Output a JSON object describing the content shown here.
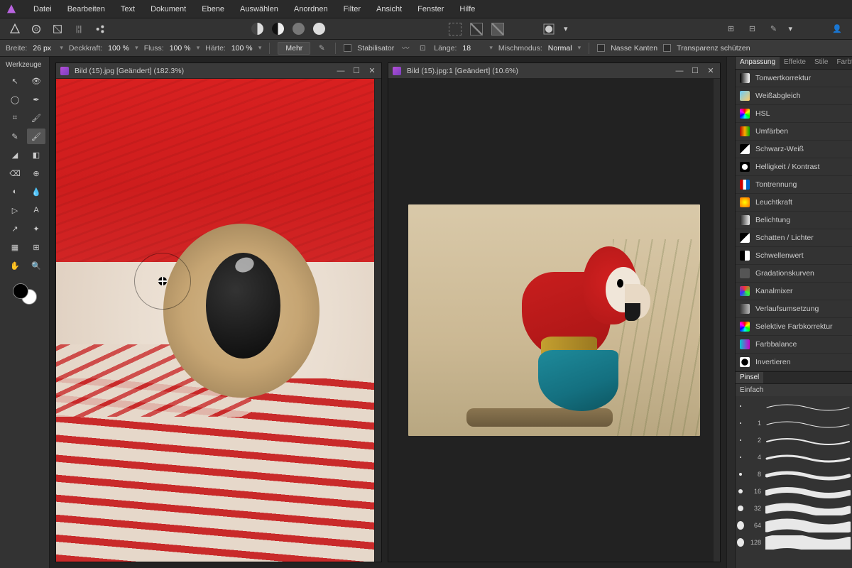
{
  "menu": [
    "Datei",
    "Bearbeiten",
    "Text",
    "Dokument",
    "Ebene",
    "Auswählen",
    "Anordnen",
    "Filter",
    "Ansicht",
    "Fenster",
    "Hilfe"
  ],
  "options": {
    "breite_lbl": "Breite:",
    "breite_val": "26 px",
    "deck_lbl": "Deckkraft:",
    "deck_val": "100 %",
    "fluss_lbl": "Fluss:",
    "fluss_val": "100 %",
    "haerte_lbl": "Härte:",
    "haerte_val": "100 %",
    "mehr": "Mehr",
    "stabil": "Stabilisator",
    "laenge_lbl": "Länge:",
    "laenge_val": "18",
    "misch_lbl": "Mischmodus:",
    "misch_val": "Normal",
    "nasse": "Nasse Kanten",
    "trans": "Transparenz schützen"
  },
  "toolbox_title": "Werkzeuge",
  "doc1_title": "Bild (15).jpg [Geändert] (182.3%)",
  "doc2_title": "Bild (15).jpg:1 [Geändert] (10.6%)",
  "panel_tabs": [
    "Anpassung",
    "Effekte",
    "Stile",
    "Farbfelder"
  ],
  "adjustments": [
    {
      "label": "Tonwertkorrektur",
      "c": "linear-gradient(90deg,#000,#fff)"
    },
    {
      "label": "Weißabgleich",
      "c": "linear-gradient(135deg,#6cf,#fc6)"
    },
    {
      "label": "HSL",
      "c": "conic-gradient(red,yellow,lime,cyan,blue,magenta,red)"
    },
    {
      "label": "Umfärben",
      "c": "linear-gradient(90deg,#a00,#fa0,#0a0)"
    },
    {
      "label": "Schwarz-Weiß",
      "c": "linear-gradient(135deg,#000 50%,#fff 50%)"
    },
    {
      "label": "Helligkeit / Kontrast",
      "c": "radial-gradient(circle,#fff 40%,#000 42%)"
    },
    {
      "label": "Tontrennung",
      "c": "linear-gradient(90deg,#c00 33%,#fff 33% 66%,#06c 66%)"
    },
    {
      "label": "Leuchtkraft",
      "c": "radial-gradient(circle,#ff0,#f60)"
    },
    {
      "label": "Belichtung",
      "c": "linear-gradient(90deg,#222,#eee)"
    },
    {
      "label": "Schatten / Lichter",
      "c": "linear-gradient(135deg,#000 50%,#fff 50%)"
    },
    {
      "label": "Schwellenwert",
      "c": "linear-gradient(90deg,#000 50%,#fff 50%)"
    },
    {
      "label": "Gradationskurven",
      "c": "#555"
    },
    {
      "label": "Kanalmixer",
      "c": "conic-gradient(#f33,#3f3,#33f,#f33)"
    },
    {
      "label": "Verlaufsumsetzung",
      "c": "linear-gradient(90deg,#333,#bbb)"
    },
    {
      "label": "Selektive Farbkorrektur",
      "c": "conic-gradient(red,yellow,lime,cyan,blue,magenta,red)"
    },
    {
      "label": "Farbbalance",
      "c": "linear-gradient(90deg,#0cc,#c0c)"
    },
    {
      "label": "Invertieren",
      "c": "radial-gradient(circle,#000 45%,#fff 50%)"
    }
  ],
  "brush_tab": "Pinsel",
  "brush_cat": "Einfach",
  "brushes": [
    {
      "size": "",
      "w": 1
    },
    {
      "size": "1",
      "w": 1
    },
    {
      "size": "2",
      "w": 2
    },
    {
      "size": "4",
      "w": 3
    },
    {
      "size": "8",
      "w": 5
    },
    {
      "size": "16",
      "w": 8
    },
    {
      "size": "32",
      "w": 11
    },
    {
      "size": "64",
      "w": 15
    },
    {
      "size": "128",
      "w": 20
    }
  ]
}
